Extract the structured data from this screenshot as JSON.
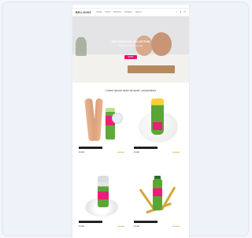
{
  "site": {
    "logo": "BELLSONY",
    "menu": [
      "HOME",
      "SHOP",
      "BRANDS",
      "OFFERS",
      "ABOUT"
    ],
    "icons": [
      "search-icon",
      "user-icon",
      "cart-icon"
    ]
  },
  "hero": {
    "title": "NEW SKINCARE COLLECTION",
    "subtitle": "Discover care for your skin",
    "button_label": "SHOP"
  },
  "products_section": {
    "title": "Lorem ipsum dolor sit amet, consectetur"
  },
  "products": [
    {
      "price": "€ 9.99",
      "rating": "★★★★★"
    },
    {
      "price": "€ 9.99",
      "rating": "★★★★★"
    },
    {
      "price": "€ 9.99",
      "rating": "★★★★★"
    },
    {
      "price": "€ 9.99",
      "rating": "★★★★★"
    }
  ],
  "colors": {
    "accent": "#e5126b",
    "brand_green": "#5aa635"
  }
}
